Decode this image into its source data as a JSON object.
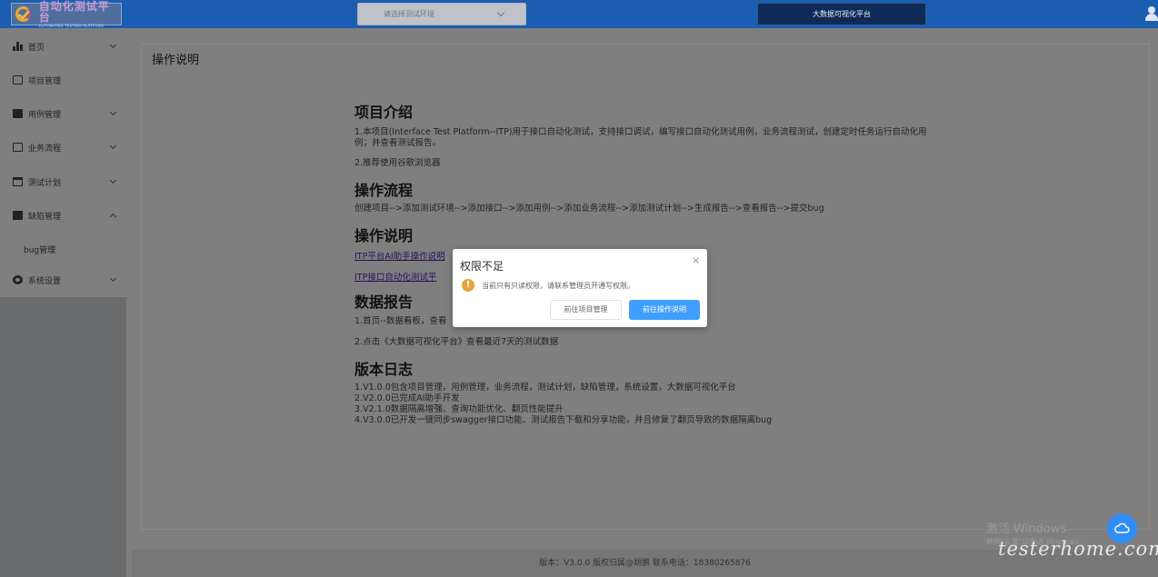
{
  "header": {
    "logo_title": "自动化测试平台",
    "logo_subtitle": "AUTOMATED TESTING PLATFORM",
    "env_placeholder": "请选择测试环境",
    "bigdata_button": "大数据可视化平台"
  },
  "sidebar": {
    "items": [
      {
        "label": "首页",
        "icon": "bar-chart-icon",
        "arrow": "down"
      },
      {
        "label": "项目管理",
        "icon": "folder-icon",
        "arrow": ""
      },
      {
        "label": "用例管理",
        "icon": "briefcase-icon",
        "arrow": "down"
      },
      {
        "label": "业务流程",
        "icon": "case-icon",
        "arrow": "down"
      },
      {
        "label": "测试计划",
        "icon": "calendar-icon",
        "arrow": "down"
      },
      {
        "label": "缺陷管理",
        "icon": "document-icon",
        "arrow": "up"
      },
      {
        "label": "bug管理",
        "icon": "",
        "arrow": ""
      },
      {
        "label": "系统设置",
        "icon": "gear-icon",
        "arrow": "down"
      }
    ]
  },
  "main": {
    "page_title": "操作说明",
    "sections": {
      "intro_heading": "项目介绍",
      "intro_p1": "1.本项目(Interface Test Platform--ITP)用于接口自动化测试，支持接口调试，编写接口自动化测试用例，业务流程测试，创建定时任务运行自动化用例；并查看测试报告。",
      "intro_p2": "2.推荐使用谷歌浏览器",
      "flow_heading": "操作流程",
      "flow_p1": "创建项目-->添加测试环境-->添加接口-->添加用例-->添加业务流程-->添加测试计划-->生成报告-->查看报告-->提交bug",
      "guide_heading": "操作说明",
      "guide_link1": "ITP平台AI助手操作说明",
      "guide_link2": "ITP接口自动化测试平",
      "report_heading": "数据报告",
      "report_p1": "1.首页--数据看板，查看",
      "report_p2": "2.点击《大数据可视化平台》查看最近7天的测试数据",
      "log_heading": "版本日志",
      "log_p1": "1.V1.0.0包含项目管理，用例管理，业务流程，测试计划，缺陷管理，系统设置，大数据可视化平台",
      "log_p2": "2.V2.0.0已完成AI助手开发",
      "log_p3": "3.V2.1.0数据隔离增强、查询功能优化、翻页性能提升",
      "log_p4": "4.V3.0.0已开发一键同步swagger接口功能、测试报告下载和分享功能，并且修复了翻页导致的数据隔离bug"
    }
  },
  "footer": {
    "text": "版本：V3.0.0 版权归属@胡鹏 联系电话：18380265876"
  },
  "modal": {
    "title": "权限不足",
    "close": "×",
    "warn_glyph": "!",
    "message": "当前只有只读权限，请联系管理员开通写权限。",
    "secondary_button": "前往项目管理",
    "primary_button": "前往操作说明"
  },
  "overlay": {
    "windows_line1": "激活 Windows",
    "windows_line2": "转到\"设置\"以激活 Windows。",
    "watermark": "testerhome.com"
  }
}
